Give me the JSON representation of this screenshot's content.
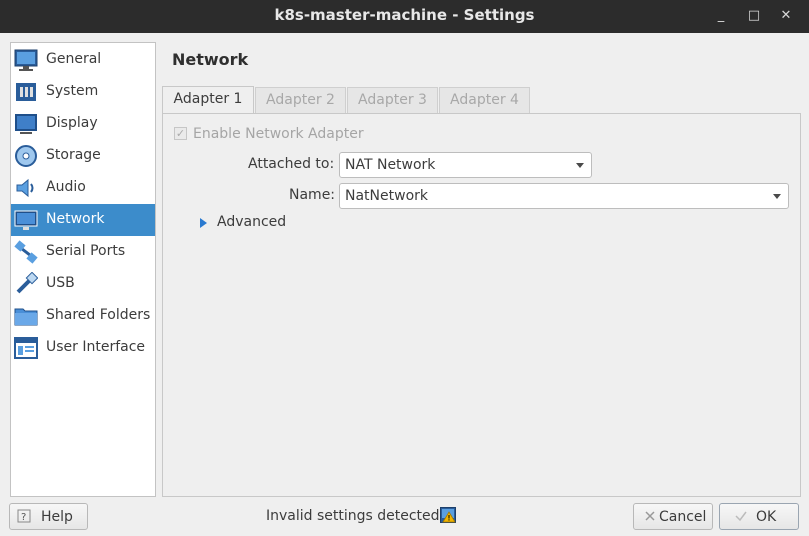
{
  "window": {
    "title": "k8s-master-machine - Settings",
    "controls": {
      "minimize": "_",
      "maximize": "□",
      "close": "✕"
    }
  },
  "sidebar": {
    "items": [
      {
        "label": "General",
        "icon": "monitor-icon",
        "selected": false
      },
      {
        "label": "System",
        "icon": "chip-icon",
        "selected": false
      },
      {
        "label": "Display",
        "icon": "display-icon",
        "selected": false
      },
      {
        "label": "Storage",
        "icon": "disc-icon",
        "selected": false
      },
      {
        "label": "Audio",
        "icon": "speaker-icon",
        "selected": false
      },
      {
        "label": "Network",
        "icon": "network-icon",
        "selected": true
      },
      {
        "label": "Serial Ports",
        "icon": "serial-port-icon",
        "selected": false
      },
      {
        "label": "USB",
        "icon": "usb-icon",
        "selected": false
      },
      {
        "label": "Shared Folders",
        "icon": "folder-icon",
        "selected": false
      },
      {
        "label": "User Interface",
        "icon": "window-icon",
        "selected": false
      }
    ]
  },
  "main": {
    "title": "Network",
    "tabs": [
      {
        "label": "Adapter 1",
        "active": true
      },
      {
        "label": "Adapter 2",
        "active": false
      },
      {
        "label": "Adapter 3",
        "active": false
      },
      {
        "label": "Adapter 4",
        "active": false
      }
    ],
    "enable_adapter": {
      "label": "Enable Network Adapter",
      "checked": true,
      "enabled": false
    },
    "attached_to": {
      "label": "Attached to:",
      "value": "NAT Network"
    },
    "name": {
      "label": "Name:",
      "value": "NatNetwork"
    },
    "advanced": {
      "label": "Advanced"
    }
  },
  "footer": {
    "help_label": "Help",
    "status_text": "Invalid settings detected",
    "cancel_label": "Cancel",
    "ok_label": "OK"
  },
  "colors": {
    "accent": "#3c8ccb",
    "titlebar": "#2c2c2c",
    "expander": "#2a7ad0",
    "warning": "#f0b400"
  }
}
